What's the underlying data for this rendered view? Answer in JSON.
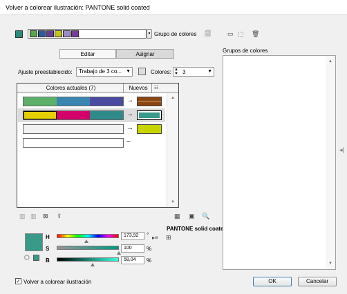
{
  "window": {
    "title": "Volver a colorear ilustración: PANTONE solid coated"
  },
  "top": {
    "active_swatch": "#2a8c7a",
    "group_strip_colors": [
      "#5aa44a",
      "#2d5a9a",
      "#6a3c9a",
      "#c4c418",
      "#9a8cc4",
      "#7a3c9a"
    ],
    "group_label": "Grupo de colores"
  },
  "tabs": {
    "edit": "Editar",
    "assign": "Asignar"
  },
  "preset": {
    "label": "Ajuste preestablecido:",
    "value": "Trabajo de 3 co...",
    "colors_label": "Colores:",
    "colors_value": "3"
  },
  "table": {
    "current_header": "Colores actuales (7)",
    "new_header": "Nuevos",
    "rows": [
      {
        "current": [
          "#5cb06a",
          "#3a86b0",
          "#4a4aa0"
        ],
        "arrow": "→",
        "new": "#8b4513",
        "new_style": "striped"
      },
      {
        "current": [
          "#e5cf00",
          "#d4006a",
          "#2f8a8a"
        ],
        "arrow": "→",
        "new": "#3a9a8a",
        "new_style": "selected"
      },
      {
        "current": [
          "#f2f2f2"
        ],
        "arrow": "→",
        "new": "#c8d400",
        "new_style": "plain"
      },
      {
        "current": [
          "#ffffff"
        ],
        "arrow": "–",
        "new": "",
        "new_style": "none"
      }
    ]
  },
  "editor": {
    "library": "PANTONE solid coated",
    "current_color": "#3a9a8a",
    "h_label": "H",
    "h_value": "173,92",
    "h_unit": "°",
    "s_label": "S",
    "s_value": "100",
    "s_unit": "%",
    "b_label": "B",
    "b_value": "58,04",
    "b_unit": "%",
    "h_level": 0.48,
    "s_level": 1.0,
    "b_level": 0.58
  },
  "groups": {
    "title": "Grupos de colores"
  },
  "footer": {
    "recolor_label": "Volver a colorear ilustración",
    "recolor_checked": true,
    "ok": "OK",
    "cancel": "Cancelar"
  }
}
